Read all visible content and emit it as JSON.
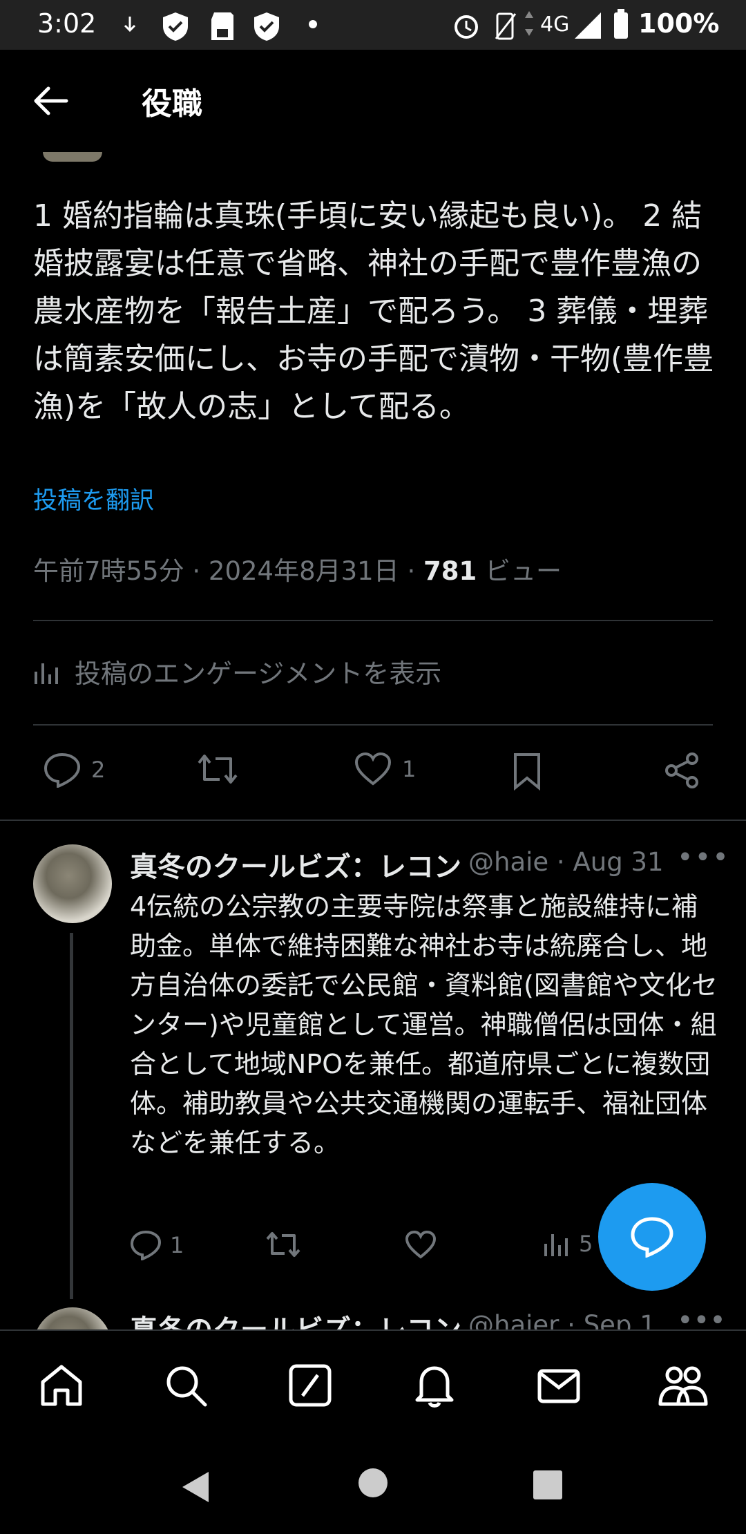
{
  "status_bar": {
    "time": "3:02",
    "network": "4G",
    "battery": "100%"
  },
  "header": {
    "title": "役職"
  },
  "post": {
    "text": "1 婚約指輪は真珠(手頃に安い縁起も良い)。 2 結婚披露宴は任意で省略、神社の手配で豊作豊漁の農水産物を「報告土産」で配ろう。 3 葬儀・埋葬は簡素安価にし、お寺の手配で漬物・干物(豊作豊漁)を「故人の志」として配る。",
    "translate_label": "投稿を翻訳",
    "time": "午前7時55分",
    "date": "2024年8月31日",
    "views": "781",
    "views_label": "ビュー",
    "engagement_label": "投稿のエンゲージメントを表示",
    "reply_count": "2",
    "like_count": "1"
  },
  "reply": {
    "name": "真冬のクールビズ：レコンキスタ",
    "handle": "@haie",
    "date": "Aug 31",
    "text": "4伝統の公宗教の主要寺院は祭事と施設維持に補助金。単体で維持困難な神社お寺は統廃合し、地方自治体の委託で公民館・資料館(図書館や文化センター)や児童館として運営。神職僧侶は団体・組合として地域NPOを兼任。都道府県ごとに複数団体。補助教員や公共交通機関の運転手、福祉団体などを兼任する。",
    "reply_count": "1",
    "views_count": "5"
  },
  "reply2": {
    "name": "真冬のクールビズ：レコンキスタ",
    "handle": "@haier",
    "date": "Sep 1"
  },
  "colors": {
    "accent": "#1d9bf0",
    "muted": "#71767b",
    "divider": "#2f3336"
  },
  "icons": [
    "back-arrow-icon",
    "reply-icon",
    "retweet-icon",
    "like-icon",
    "bookmark-icon",
    "share-icon",
    "analytics-icon",
    "home-icon",
    "search-icon",
    "grok-icon",
    "bell-icon",
    "mail-icon",
    "communities-icon",
    "compose-reply-icon"
  ]
}
